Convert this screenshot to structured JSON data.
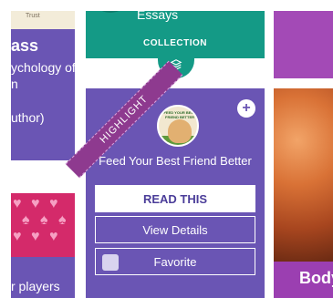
{
  "left_top": {
    "title": "ass",
    "lines": [
      "ychology of",
      "n",
      "uthor)"
    ],
    "book_label": "Trust"
  },
  "left_bottom": {
    "caption": "r players"
  },
  "collection": {
    "title": "Essays",
    "label": "COLLECTION",
    "badge_icon": "layers-icon"
  },
  "book": {
    "ribbon": "HIGHLIGHT",
    "add_icon": "plus",
    "thumbnail_text": "FEED YOUR BEST FRIEND BETTER",
    "title": "Feed Your Best Friend Better",
    "read_label": "READ THIS",
    "details_label": "View Details",
    "favorite_label": "Favorite",
    "favorite_checked": false
  },
  "right_card": {
    "title": "Body"
  },
  "colors": {
    "purple": "#6a55b4",
    "teal": "#149a86",
    "ribbon": "#8e3a8f",
    "magenta": "#a34ab6"
  }
}
